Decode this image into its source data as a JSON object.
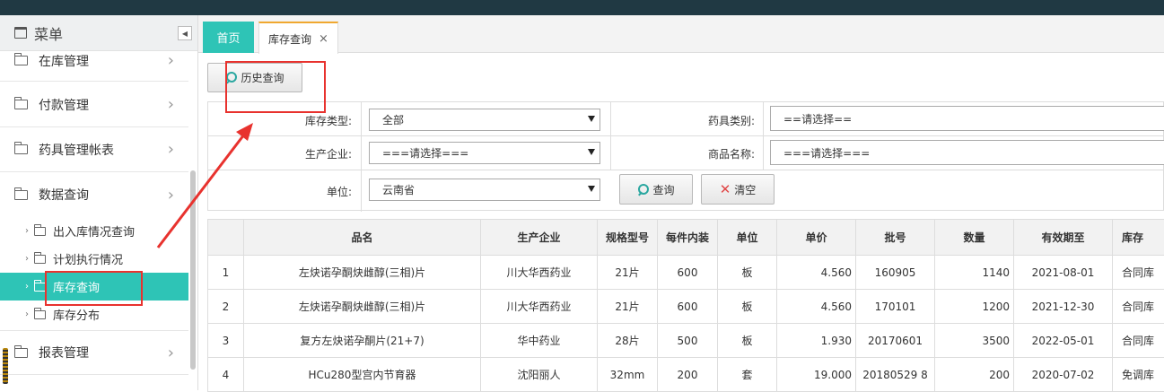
{
  "colors": {
    "accent": "#2ec4b6",
    "topbar": "#203943",
    "tab_active_border": "#f0a830",
    "annotation": "#e8322e"
  },
  "sidebar": {
    "header": "菜单",
    "items": [
      {
        "label": "在库管理"
      },
      {
        "label": "付款管理"
      },
      {
        "label": "药具管理帐表"
      },
      {
        "label": "数据查询"
      },
      {
        "label": "报表管理"
      }
    ],
    "sub_items": [
      {
        "label": "出入库情况查询"
      },
      {
        "label": "计划执行情况"
      },
      {
        "label": "库存查询"
      },
      {
        "label": "库存分布"
      }
    ]
  },
  "tabs": {
    "home": "首页",
    "stock": "库存查询"
  },
  "toolbar": {
    "history_label": "历史查询"
  },
  "filters": {
    "stock_type": {
      "label": "库存类型:",
      "value": "全部"
    },
    "drug_category": {
      "label": "药具类别:",
      "value": "==请选择=="
    },
    "manufacturer": {
      "label": "生产企业:",
      "value": "===请选择==="
    },
    "product_name": {
      "label": "商品名称:",
      "value": "===请选择==="
    },
    "unit": {
      "label": "单位:",
      "value": "云南省"
    },
    "query_label": "查询",
    "clear_label": "清空"
  },
  "table": {
    "headers": [
      "",
      "品名",
      "生产企业",
      "规格型号",
      "每件内装",
      "单位",
      "单价",
      "批号",
      "数量",
      "有效期至",
      "库存"
    ],
    "rows": [
      [
        "1",
        "左炔诺孕酮炔雌醇(三相)片",
        "川大华西药业",
        "21片",
        "600",
        "板",
        "4.560",
        "160905",
        "1140",
        "2021-08-01",
        "合同库"
      ],
      [
        "2",
        "左炔诺孕酮炔雌醇(三相)片",
        "川大华西药业",
        "21片",
        "600",
        "板",
        "4.560",
        "170101",
        "1200",
        "2021-12-30",
        "合同库"
      ],
      [
        "3",
        "复方左炔诺孕酮片(21+7)",
        "华中药业",
        "28片",
        "500",
        "板",
        "1.930",
        "20170601",
        "3500",
        "2022-05-01",
        "合同库"
      ],
      [
        "4",
        "HCu280型宫内节育器",
        "沈阳丽人",
        "32mm",
        "200",
        "套",
        "19.000",
        "20180529 8",
        "200",
        "2020-07-02",
        "免调库"
      ]
    ]
  }
}
